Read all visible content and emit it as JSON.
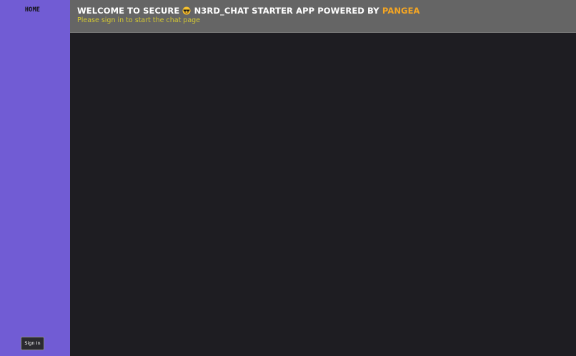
{
  "sidebar": {
    "home_label": "HOME",
    "signin_label": "Sign In"
  },
  "header": {
    "title_prefix": "WELCOME TO SECURE",
    "title_emoji_icon": "sunglasses-face-emoji",
    "title_middle": "N3RD_CHAT STARTER APP POWERED BY",
    "title_brand": "PANGEA",
    "subtitle": "Please sign in to start the chat page"
  },
  "colors": {
    "sidebar_bg": "#715cd4",
    "header_bg": "#656565",
    "content_bg": "#1e1d22",
    "brand_accent": "#f5a623",
    "subtitle_text": "#d4c832"
  }
}
